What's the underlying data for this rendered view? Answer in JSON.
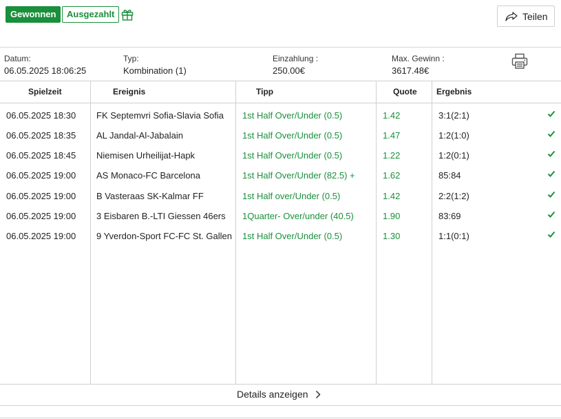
{
  "header": {
    "badge_won": "Gewonnen",
    "badge_paid": "Ausgezahlt",
    "share_label": "Teilen",
    "accent_color": "#1a8f3c",
    "gift_icon": "gift-icon",
    "share_icon": "share-arrow-icon"
  },
  "info": {
    "date_label": "Datum:",
    "date_value": "06.05.2025 18:06:25",
    "type_label": "Typ:",
    "type_value": "Kombination (1)",
    "stake_label": "Einzahlung :",
    "stake_value": "250.00€",
    "maxwin_label": "Max. Gewinn :",
    "maxwin_value": "3617.48€",
    "print_icon": "printer-icon"
  },
  "table": {
    "columns": [
      "Spielzeit",
      "Ereignis",
      "Tipp",
      "Quote",
      "Ergebnis"
    ],
    "rows": [
      {
        "time": "06.05.2025 18:30",
        "event": "FK Septemvri Sofia-Slavia Sofia",
        "tip": "1st Half Over/Under (0.5)",
        "odds": "1.42",
        "result": "3:1(2:1)",
        "status": "won"
      },
      {
        "time": "06.05.2025 18:35",
        "event": "AL Jandal-Al-Jabalain",
        "tip": "1st Half Over/Under (0.5)",
        "odds": "1.47",
        "result": "1:2(1:0)",
        "status": "won"
      },
      {
        "time": "06.05.2025 18:45",
        "event": "Niemisen Urheilijat-Hapk",
        "tip": "1st Half Over/Under (0.5)",
        "odds": "1.22",
        "result": "1:2(0:1)",
        "status": "won"
      },
      {
        "time": "06.05.2025 19:00",
        "event": "AS Monaco-FC Barcelona",
        "tip": "1st Half Over/Under (82.5) +",
        "odds": "1.62",
        "result": "85:84",
        "status": "won"
      },
      {
        "time": "06.05.2025 19:00",
        "event": "B Vasteraas SK-Kalmar FF",
        "tip": "1st Half over/Under (0.5)",
        "odds": "1.42",
        "result": "2:2(1:2)",
        "status": "won"
      },
      {
        "time": "06.05.2025 19:00",
        "event": "3 Eisbaren B.-LTI Giessen 46ers",
        "tip": "1Quarter- Over/under (40.5)",
        "odds": "1.90",
        "result": "83:69",
        "status": "won"
      },
      {
        "time": "06.05.2025 19:00",
        "event": "9 Yverdon-Sport FC-FC St. Gallen",
        "tip": "1st Half Over/Under (0.5)",
        "odds": "1.30",
        "result": "1:1(0:1)",
        "status": "won"
      }
    ]
  },
  "footer": {
    "details_label": "Details anzeigen",
    "chevron_icon": "chevron-right-icon"
  }
}
